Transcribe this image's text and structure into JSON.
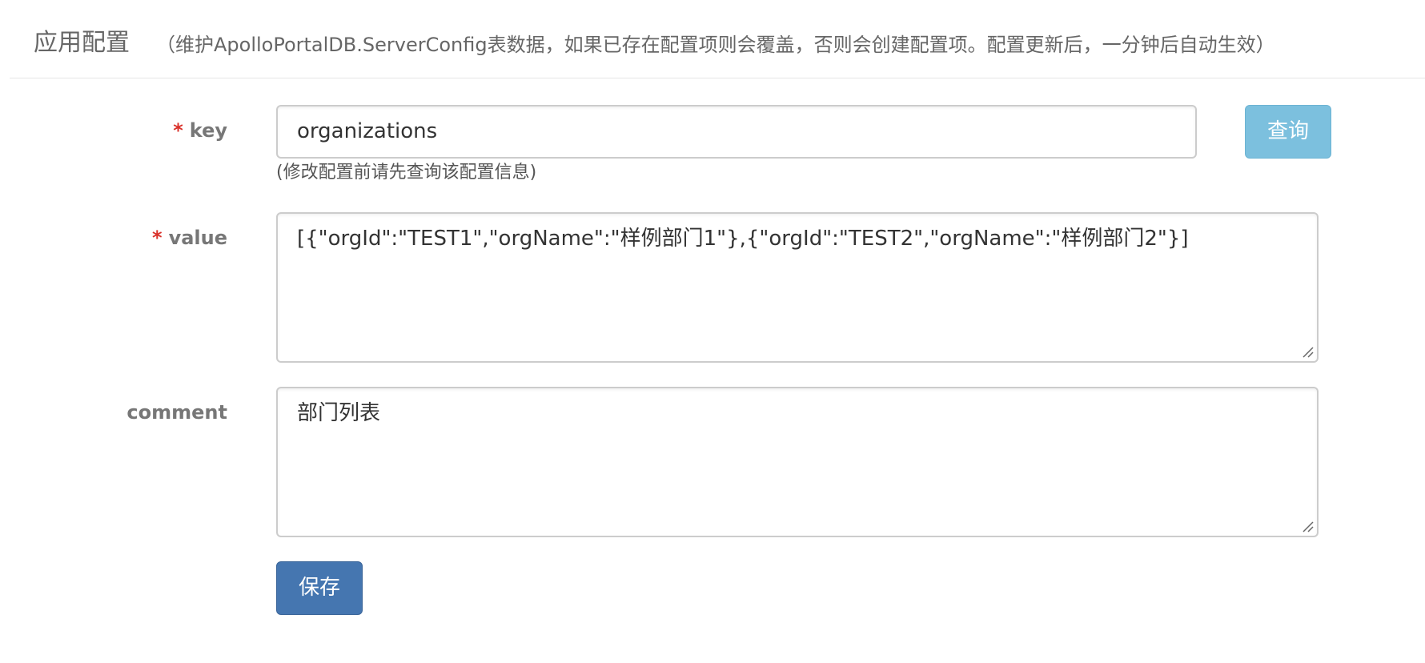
{
  "header": {
    "title": "应用配置",
    "description": "（维护ApolloPortalDB.ServerConfig表数据，如果已存在配置项则会覆盖，否则会创建配置项。配置更新后，一分钟后自动生效）"
  },
  "form": {
    "required_mark": "*",
    "key": {
      "label": "key",
      "value": "organizations",
      "hint": "(修改配置前请先查询该配置信息)"
    },
    "value": {
      "label": "value",
      "value": "[{\"orgId\":\"TEST1\",\"orgName\":\"样例部门1\"},{\"orgId\":\"TEST2\",\"orgName\":\"样例部门2\"}]"
    },
    "comment": {
      "label": "comment",
      "value": "部门列表"
    }
  },
  "buttons": {
    "query_label": "查询",
    "save_label": "保存"
  },
  "colors": {
    "required": "#d9312a",
    "query_button": "#7cc0de",
    "save_button": "#4576b0"
  }
}
